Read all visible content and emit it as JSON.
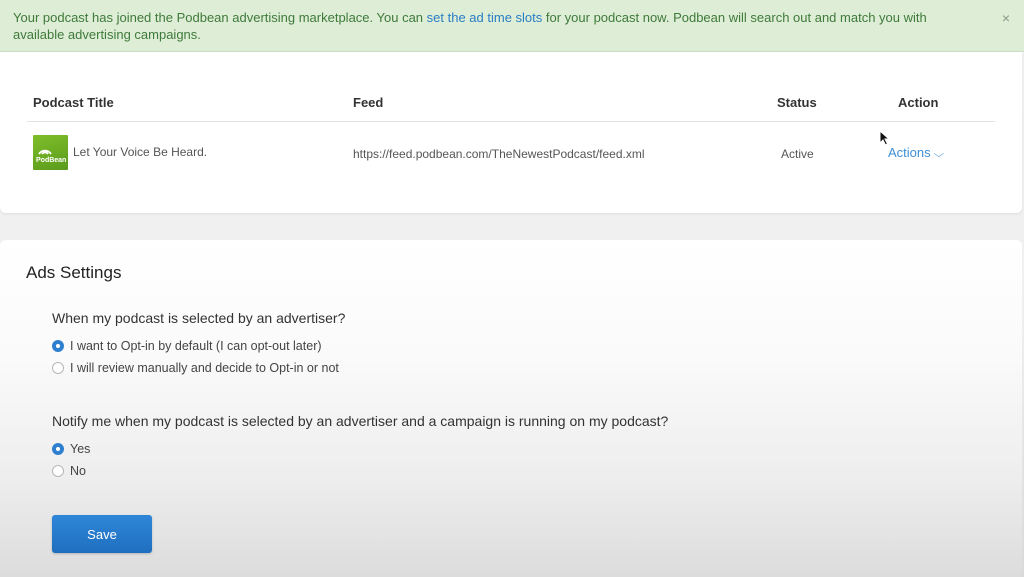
{
  "alert": {
    "text_before": "Your podcast has joined the Podbean advertising marketplace. You can ",
    "link_text": "set the ad time slots",
    "text_after": " for your podcast now. Podbean will search out and match you with available advertising campaigns.",
    "close_symbol": "×"
  },
  "table": {
    "headers": {
      "title": "Podcast Title",
      "feed": "Feed",
      "status": "Status",
      "action": "Action"
    },
    "row": {
      "cover_brand": "PodBean",
      "title": "Let Your Voice Be Heard.",
      "feed": "https://feed.podbean.com/TheNewestPodcast/feed.xml",
      "status": "Active",
      "action_label": "Actions",
      "action_icon": "chevron-down-icon"
    }
  },
  "ads_settings": {
    "title": "Ads Settings",
    "q1": {
      "question": "When my podcast is selected by an advertiser?",
      "options": [
        {
          "label": "I want to Opt-in by default (I can opt-out later)",
          "selected": true
        },
        {
          "label": "I will review manually and decide to Opt-in or not",
          "selected": false
        }
      ]
    },
    "q2": {
      "question": "Notify me when my podcast is selected by an advertiser and a campaign is running on my podcast?",
      "options": [
        {
          "label": "Yes",
          "selected": true
        },
        {
          "label": "No",
          "selected": false
        }
      ]
    },
    "save_label": "Save"
  },
  "colors": {
    "accent": "#2f7fd1",
    "alert_bg": "#ddedd6",
    "alert_text": "#3f7a3a",
    "link": "#2a7dc4",
    "cover_green": "#6fae24"
  }
}
